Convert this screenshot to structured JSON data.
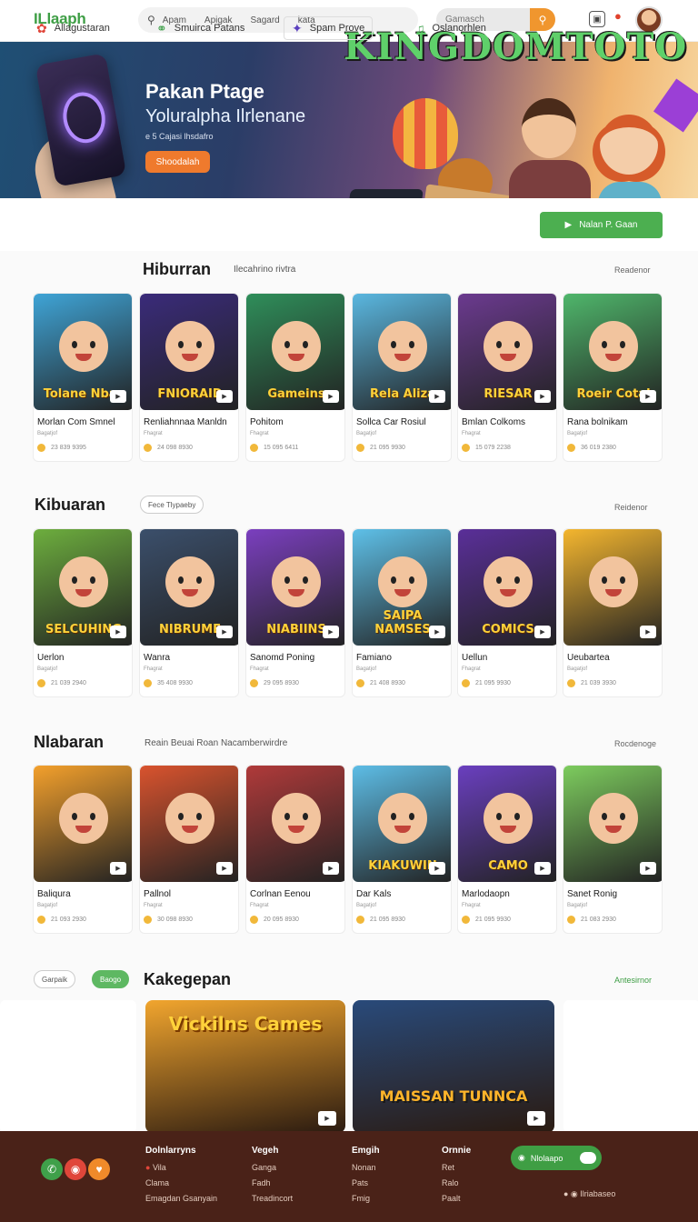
{
  "header": {
    "logo": "ILlaaph",
    "nav": [
      "Apam",
      "Apigak",
      "Sagard",
      "kata"
    ],
    "search_placeholder": "Gamasch"
  },
  "hero": {
    "title": "Pakan Ptage",
    "subtitle": "Yoluralpha Ilrlenane",
    "small": "e 5 Cajasi lhsdafro",
    "button": "Shoodalah",
    "brand": "KINGDOMTOTO"
  },
  "categories": [
    {
      "label": "Allagustaran",
      "icon": "pinwheel-icon"
    },
    {
      "label": "Smuirca Patans",
      "icon": "globe-icon"
    },
    {
      "label": "Spam Prove",
      "icon": "star-icon"
    },
    {
      "label": "Oslanorhlen",
      "icon": "music-icon"
    }
  ],
  "category_cta": "Nalan P. Gaan",
  "sections": [
    {
      "title": "Hiburran",
      "note": "Ilecahrino rivtra",
      "more": "Readenor",
      "cards": [
        {
          "name": "Morlan Com Smnel",
          "tag": "Bagatjof",
          "meta": "23 839 9395",
          "word": "Tolane Nbas",
          "color": "#3fa4d6"
        },
        {
          "name": "Renliahnnaa Manldn",
          "tag": "Fhagrat",
          "meta": "24 098 8930",
          "word": "FNIORAID",
          "color": "#3a2b7a"
        },
        {
          "name": "Pohitom",
          "tag": "Fhagrat",
          "meta": "15 095 6411",
          "word": "Gameins",
          "color": "#2f8e5a"
        },
        {
          "name": "Sollca Car Rosiul",
          "tag": "Bagatjof",
          "meta": "21 095 9930",
          "word": "Rela Aliza",
          "color": "#5ab7e0"
        },
        {
          "name": "Bmlan Colkoms",
          "tag": "Fhagrat",
          "meta": "15 079 2238",
          "word": "RIESAR",
          "color": "#6b3a8f"
        },
        {
          "name": "Rana bolnikam",
          "tag": "Bagatjof",
          "meta": "36 019 2380",
          "word": "Roeir Cotal",
          "color": "#4fb66b"
        }
      ]
    },
    {
      "title": "Kibuaran",
      "note": "Fece Tlypaeby",
      "more": "Reidenor",
      "cards": [
        {
          "name": "Uerlon",
          "tag": "Bagatjof",
          "meta": "21 039 2940",
          "word": "SELCUHING",
          "color": "#6dae3e"
        },
        {
          "name": "Wanra",
          "tag": "Fhagrat",
          "meta": "35 408 9930",
          "word": "NIBRUME",
          "color": "#3b4f6b"
        },
        {
          "name": "Sanomd Poning",
          "tag": "Fhagrat",
          "meta": "29 095 8930",
          "word": "NIABIINS",
          "color": "#7b3fbf"
        },
        {
          "name": "Famiano",
          "tag": "Bagatjof",
          "meta": "21 408 8930",
          "word": "SAIPA NAMSES",
          "color": "#5ec0e8"
        },
        {
          "name": "Uellun",
          "tag": "Fhagrat",
          "meta": "21 095 9930",
          "word": "COMICS",
          "color": "#5a2f99"
        },
        {
          "name": "Ueubartea",
          "tag": "Bagatjof",
          "meta": "21 039 3930",
          "word": "",
          "color": "#f4b62f"
        }
      ]
    },
    {
      "title": "Nlabaran",
      "note": "Reain Beuai Roan  Nacamberwirdre",
      "more": "Rocdenoge",
      "cards": [
        {
          "name": "Baliqura",
          "tag": "Bagatjof",
          "meta": "21 093 2930",
          "word": "",
          "color": "#f3a02c"
        },
        {
          "name": "Pallnol",
          "tag": "Fhagrat",
          "meta": "30 098 8930",
          "word": "",
          "color": "#d9532e"
        },
        {
          "name": "Corlnan Eenou",
          "tag": "Fhagrat",
          "meta": "20 095 8930",
          "word": "",
          "color": "#b03a3a"
        },
        {
          "name": "Dar Kals",
          "tag": "Bagatjof",
          "meta": "21 095 8930",
          "word": "KIAKUWIN",
          "color": "#5dbde6"
        },
        {
          "name": "Marlodaopn",
          "tag": "Fhagrat",
          "meta": "21 095 9930",
          "word": "CAMO",
          "color": "#6a3fbf"
        },
        {
          "name": "Sanet Ronig",
          "tag": "Bagatjof",
          "meta": "21 083 2930",
          "word": "",
          "color": "#7dcc5e"
        }
      ]
    }
  ],
  "featured": {
    "pills": [
      "Garpaik",
      "Baogo"
    ],
    "title": "Kakegepan",
    "more": "Antesirnor",
    "items": [
      {
        "word": "Vickilns Cames",
        "color": "#f1a52e"
      },
      {
        "word": "MAISSAN TUNNCA",
        "color": "#294a7a"
      }
    ]
  },
  "footer": {
    "columns": [
      {
        "heading": "Dolnlarryns",
        "links": [
          "Vila",
          "Clama",
          "Emagdan Gsanyain"
        ]
      },
      {
        "heading": "Vegeh",
        "links": [
          "Ganga",
          "Fadh",
          "Treadincort"
        ]
      },
      {
        "heading": "Emgih",
        "links": [
          "Nonan",
          "Pats",
          "Fmig"
        ]
      },
      {
        "heading": "Ornnie",
        "links": [
          "Ret",
          "Ralo",
          "Paalt"
        ]
      }
    ],
    "toggle_label": "Nlolaapo",
    "bottom": "Ilriabaseo",
    "social": [
      {
        "icon": "phone-icon",
        "color": "#3fa04a"
      },
      {
        "icon": "instagram-icon",
        "color": "#e0463a"
      },
      {
        "icon": "heart-icon",
        "color": "#f08a2a"
      }
    ]
  }
}
